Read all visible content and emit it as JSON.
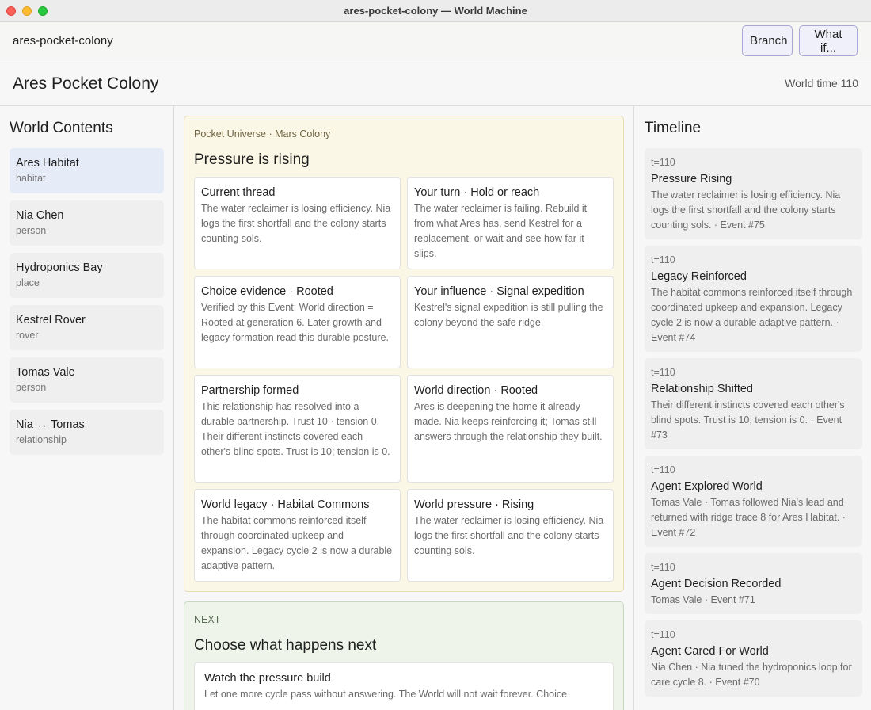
{
  "window": {
    "title": "ares-pocket-colony — World Machine"
  },
  "toolbar": {
    "world_id": "ares-pocket-colony",
    "branch_label": "Branch",
    "whatif_label": "What if..."
  },
  "header": {
    "title": "Ares Pocket Colony",
    "world_time": "World time 110"
  },
  "sidebar": {
    "title": "World Contents",
    "items": [
      {
        "name": "Ares Habitat",
        "type": "habitat",
        "active": true
      },
      {
        "name": "Nia Chen",
        "type": "person"
      },
      {
        "name": "Hydroponics Bay",
        "type": "place"
      },
      {
        "name": "Kestrel Rover",
        "type": "rover"
      },
      {
        "name": "Tomas Vale",
        "type": "person"
      },
      {
        "name": "Nia ↔ Tomas",
        "type": "relationship"
      }
    ]
  },
  "pressure_panel": {
    "kicker": "Pocket Universe · Mars Colony",
    "heading": "Pressure is rising",
    "cards": [
      {
        "title": "Current thread",
        "body": "The water reclaimer is losing efficiency. Nia logs the first shortfall and the colony starts counting sols."
      },
      {
        "title": "Your turn · Hold or reach",
        "body": "The water reclaimer is failing. Rebuild it from what Ares has, send Kestrel for a replacement, or wait and see how far it slips."
      },
      {
        "title": "Choice evidence · Rooted",
        "body": "Verified by this Event: World direction = Rooted at generation 6. Later growth and legacy formation read this durable posture."
      },
      {
        "title": "Your influence · Signal expedition",
        "body": "Kestrel's signal expedition is still pulling the colony beyond the safe ridge."
      },
      {
        "title": "Partnership formed",
        "body": "This relationship has resolved into a durable partnership. Trust 10 · tension 0. Their different instincts covered each other's blind spots. Trust is 10; tension is 0."
      },
      {
        "title": "World direction · Rooted",
        "body": "Ares is deepening the home it already made. Nia keeps reinforcing it; Tomas still answers through the relationship they built."
      },
      {
        "title": "World legacy · Habitat Commons",
        "body": "The habitat commons reinforced itself through coordinated upkeep and expansion. Legacy cycle 2 is now a durable adaptive pattern."
      },
      {
        "title": "World pressure · Rising",
        "body": "The water reclaimer is losing efficiency. Nia logs the first shortfall and the colony starts counting sols."
      }
    ]
  },
  "next_panel": {
    "kicker": "NEXT",
    "heading": "Choose what happens next",
    "option": {
      "title": "Watch the pressure build",
      "body": "Let one more cycle pass without answering. The World will not wait forever. Choice"
    }
  },
  "timeline": {
    "title": "Timeline",
    "events": [
      {
        "time": "t=110",
        "name": "Pressure Rising",
        "desc": "The water reclaimer is losing efficiency. Nia logs the first shortfall and the colony starts counting sols. · Event #75"
      },
      {
        "time": "t=110",
        "name": "Legacy Reinforced",
        "desc": "The habitat commons reinforced itself through coordinated upkeep and expansion. Legacy cycle 2 is now a durable adaptive pattern. · Event #74"
      },
      {
        "time": "t=110",
        "name": "Relationship Shifted",
        "desc": "Their different instincts covered each other's blind spots. Trust is 10; tension is 0. · Event #73"
      },
      {
        "time": "t=110",
        "name": "Agent Explored World",
        "desc": "Tomas Vale · Tomas followed Nia's lead and returned with ridge trace 8 for Ares Habitat. · Event #72"
      },
      {
        "time": "t=110",
        "name": "Agent Decision Recorded",
        "desc": "Tomas Vale · Event #71"
      },
      {
        "time": "t=110",
        "name": "Agent Cared For World",
        "desc": "Nia Chen · Nia tuned the hydroponics loop for care cycle 8. · Event #70"
      }
    ]
  }
}
